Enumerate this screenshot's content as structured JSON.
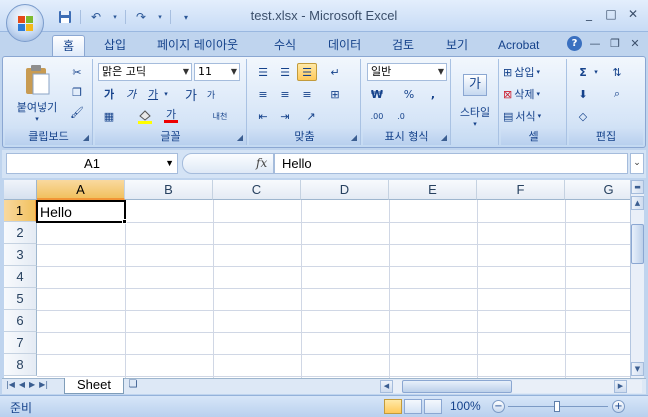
{
  "window": {
    "title": "test.xlsx - Microsoft Excel",
    "controls": [
      "_",
      "□",
      "✕"
    ]
  },
  "qat": {
    "save_icon": "save-icon",
    "undo_icon": "undo-icon",
    "redo_icon": "redo-icon"
  },
  "tabs": [
    {
      "label": "홈",
      "active": true
    },
    {
      "label": "삽입"
    },
    {
      "label": "페이지 레이아웃"
    },
    {
      "label": "수식"
    },
    {
      "label": "데이터"
    },
    {
      "label": "검토"
    },
    {
      "label": "보기"
    },
    {
      "label": "Acrobat"
    }
  ],
  "ribbon": {
    "clipboard": {
      "paste_label": "붙여넣기",
      "group_label": "클립보드"
    },
    "font": {
      "font_name": "맑은 고딕",
      "font_size": "11",
      "bold": "가",
      "italic": "가",
      "underline": "가",
      "grow": "가",
      "shrink": "가",
      "phonetic": "내천",
      "font_color_glyph": "가",
      "group_label": "글꼴"
    },
    "alignment": {
      "group_label": "맞춤"
    },
    "number": {
      "format": "일반",
      "currency": "₩",
      "percent": "%",
      "comma": ",",
      "inc_decimal": ".00",
      "dec_decimal": ".0",
      "group_label": "표시 형식"
    },
    "styles": {
      "style_label": "스타일",
      "style_glyph": "가"
    },
    "cells": {
      "insert": "삽입",
      "delete": "삭제",
      "format": "서식",
      "group_label": "셀"
    },
    "editing": {
      "sum": "Σ",
      "group_label": "편집"
    }
  },
  "formula_bar": {
    "name_box": "A1",
    "fx": "fx",
    "value": "Hello"
  },
  "grid": {
    "columns": [
      "A",
      "B",
      "C",
      "D",
      "E",
      "F",
      "G"
    ],
    "rows": [
      "1",
      "2",
      "3",
      "4",
      "5",
      "6",
      "7",
      "8"
    ],
    "cells": {
      "A1": "Hello"
    },
    "active_cell": "A1"
  },
  "sheets": [
    {
      "name": "Sheet",
      "active": true
    }
  ],
  "status": {
    "mode": "준비",
    "zoom": "100%"
  },
  "colors": {
    "ribbon_blue": "#bfd4ee",
    "selected_header": "#f9d99f",
    "text_blue": "#15428b"
  }
}
